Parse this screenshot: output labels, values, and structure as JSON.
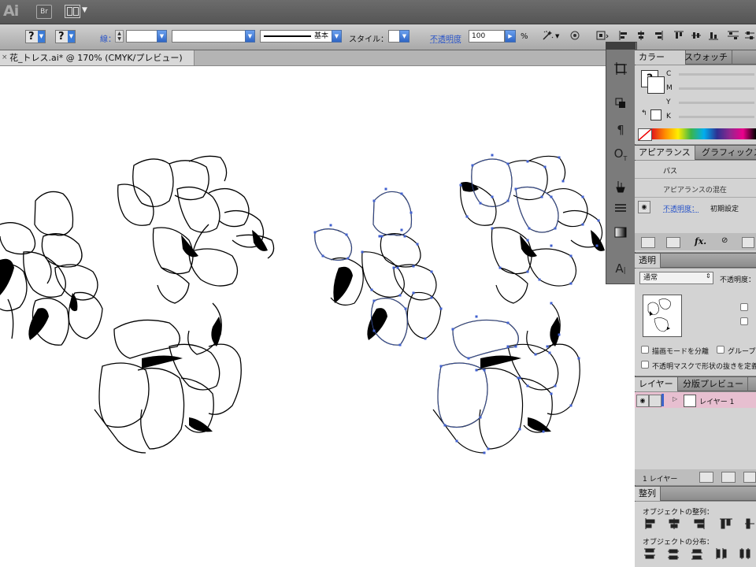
{
  "app": {
    "logo": "Ai",
    "bridge_label": "Br"
  },
  "control_bar": {
    "fill_q": "?",
    "stroke_q": "?",
    "stroke_label": "線：",
    "stroke_weight": "",
    "brush_profile": "",
    "stroke_style": "基本",
    "style_label": "スタイル：",
    "opacity_label": "不透明度",
    "opacity_value": "100",
    "opacity_unit": "%"
  },
  "document_tab": {
    "close": "×",
    "title": "花_トレス.ai* @ 170% (CMYK/プレビュー)"
  },
  "panels": {
    "color": {
      "tab_active": "カラー",
      "tab_inactive": "スウォッチ",
      "channels": [
        "C",
        "M",
        "Y",
        "K"
      ],
      "q": "?"
    },
    "appearance": {
      "tab_active": "アピアランス",
      "tab_inactive": "グラフィックス",
      "item": "パス",
      "mixed": "アピアランスの混在",
      "opacity_label": "不透明度：",
      "opacity_value": "初期設定"
    },
    "transparency": {
      "tab_active": "透明",
      "blend_mode": "通常",
      "opacity_label": "不透明度：",
      "isolate_blend": "描画モードを分離",
      "knockout_group": "グループ",
      "mask_option": "不透明マスクで形状の抜きを定義"
    },
    "layers": {
      "tab_active": "レイヤー",
      "tab_inactive": "分版プレビュー",
      "layer_name": "レイヤー 1",
      "footer_count": "1 レイヤー"
    },
    "align": {
      "tab_active": "整列",
      "align_objects": "オブジェクトの整列：",
      "distribute_objects": "オブジェクトの分布："
    }
  },
  "icons": [
    "fx-icon",
    "eye-icon",
    "gradient-icon",
    "paragraph-icon",
    "opentype-icon",
    "artboard-icon"
  ]
}
